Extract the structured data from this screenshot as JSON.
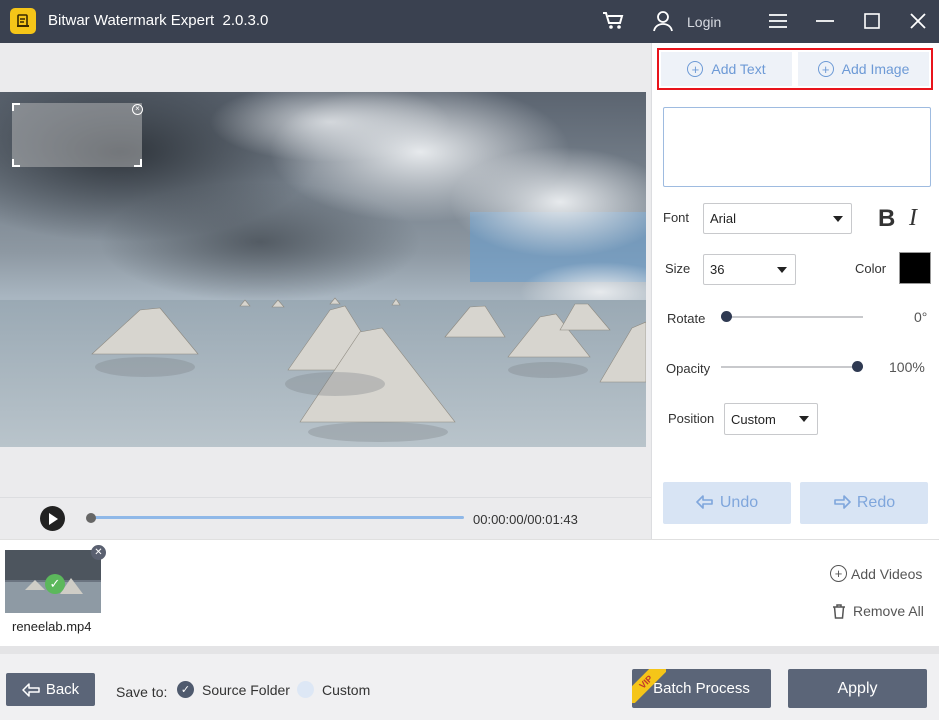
{
  "app": {
    "title": "Bitwar Watermark Expert  2.0.3.0",
    "login_label": "Login"
  },
  "colors": {
    "titlebar": "#3a4150",
    "accent_blue": "#6d9ad6",
    "highlight_red": "#e8141c",
    "button_dark": "#5b6578"
  },
  "tabs": {
    "add_text": "Add Text",
    "add_image": "Add Image"
  },
  "form": {
    "font_label": "Font",
    "font_value": "Arial",
    "bold_label": "B",
    "italic_label": "I",
    "size_label": "Size",
    "size_value": "36",
    "color_label": "Color",
    "color_value": "#000000",
    "rotate_label": "Rotate",
    "rotate_value": "0°",
    "rotate_fraction": 0,
    "opacity_label": "Opacity",
    "opacity_value": "100%",
    "opacity_fraction": 1,
    "position_label": "Position",
    "position_value": "Custom"
  },
  "actions": {
    "undo": "Undo",
    "redo": "Redo"
  },
  "player": {
    "time": "00:00:00/00:01:43",
    "progress_fraction": 0
  },
  "media": {
    "file_name": "reneelab.mp4",
    "add_videos": "Add Videos",
    "remove_all": "Remove All"
  },
  "footer": {
    "back": "Back",
    "save_to": "Save to:",
    "source_folder": "Source Folder",
    "custom": "Custom",
    "batch_process": "Batch Process",
    "vip_badge": "VIP",
    "apply": "Apply"
  }
}
